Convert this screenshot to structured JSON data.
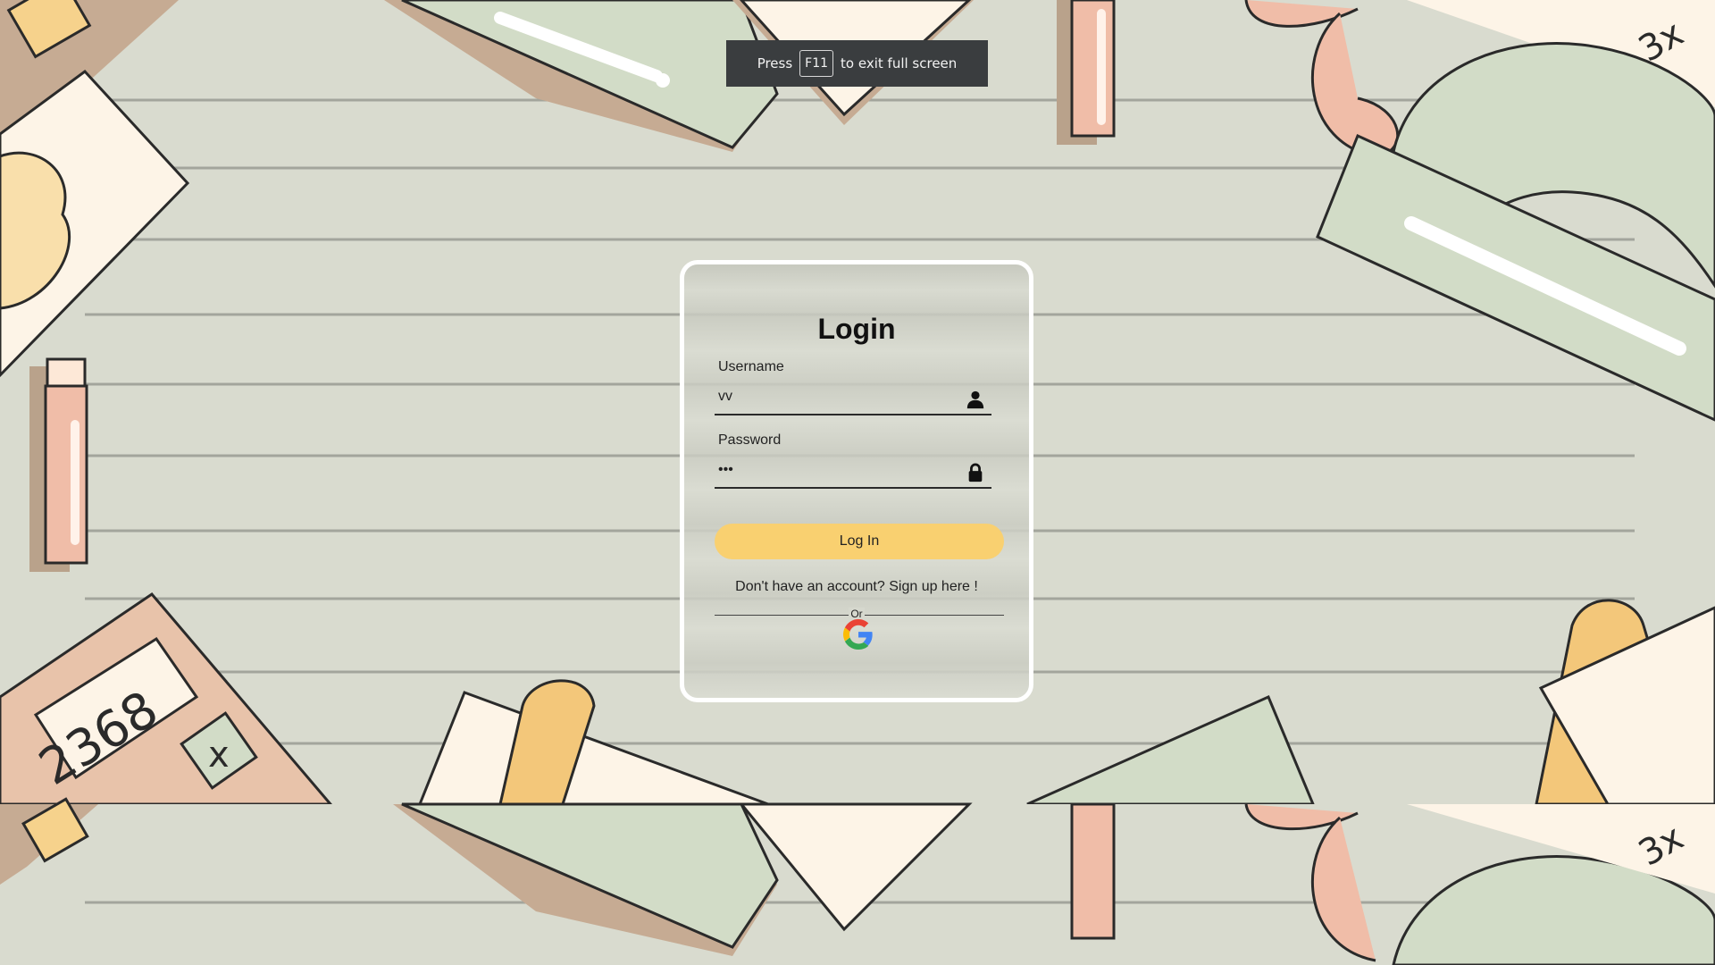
{
  "fullscreen_notice": {
    "prefix": "Press",
    "key": "F11",
    "suffix": "to exit full screen"
  },
  "login_form": {
    "title": "Login",
    "username": {
      "label": "Username",
      "value": "vv",
      "icon": "user-icon"
    },
    "password": {
      "label": "Password",
      "value": "vvv",
      "icon": "lock-icon"
    },
    "submit_label": "Log In",
    "signup_text": "Don't have an account? Sign up here !",
    "divider_text": "Or",
    "google_icon": "google-icon"
  },
  "colors": {
    "background": "#d9dbcf",
    "button": "#f9d070",
    "card_border": "#ffffff",
    "toast": "#3a3d3f"
  }
}
